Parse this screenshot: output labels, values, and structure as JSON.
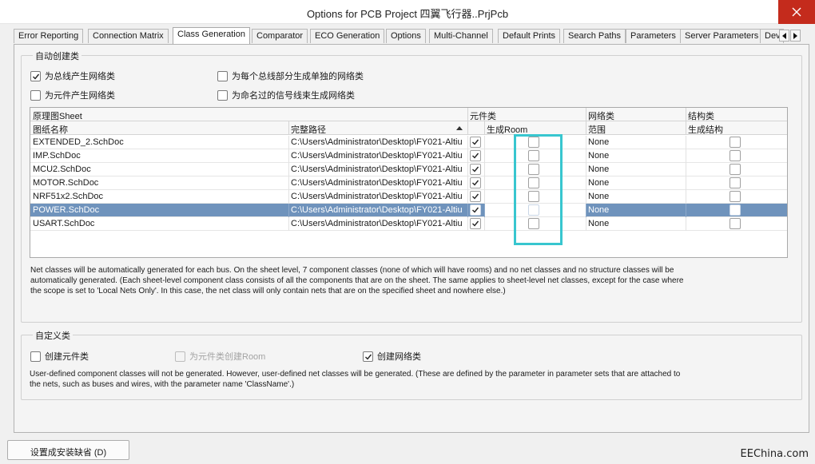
{
  "window": {
    "title": "Options for PCB Project 四翼飞行器..PrjPcb"
  },
  "tabs": [
    {
      "label": "Error Reporting",
      "active": false
    },
    {
      "label": "Connection Matrix",
      "active": false
    },
    {
      "label": "Class Generation",
      "active": true
    },
    {
      "label": "Comparator",
      "active": false
    },
    {
      "label": "ECO Generation",
      "active": false
    },
    {
      "label": "Options",
      "active": false
    },
    {
      "label": "Multi-Channel",
      "active": false
    },
    {
      "label": "Default Prints",
      "active": false
    },
    {
      "label": "Search Paths",
      "active": false
    },
    {
      "label": "Parameters",
      "active": false
    },
    {
      "label": "Server Parameters",
      "active": false
    },
    {
      "label": "Dev",
      "active": false
    }
  ],
  "auto_group": {
    "title": "自动创建类",
    "options": [
      {
        "label": "为总线产生网络类",
        "checked": true
      },
      {
        "label": "为元件产生网络类",
        "checked": false
      },
      {
        "label": "为每个总线部分生成单独的网络类",
        "checked": false
      },
      {
        "label": "为命名过的信号线束生成网络类",
        "checked": false
      }
    ],
    "grid": {
      "group_headers": [
        "原理图Sheet",
        "元件类",
        "网络类",
        "结构类"
      ],
      "columns": [
        "图纸名称",
        "完整路径",
        "生成Room",
        "范围",
        "生成结构"
      ],
      "rows": [
        {
          "sheet": "EXTENDED_2.SchDoc",
          "path": "C:\\Users\\Administrator\\Desktop\\FY021-Altiu",
          "component_class": true,
          "room": false,
          "scope": "None",
          "structure": false,
          "selected": false
        },
        {
          "sheet": "IMP.SchDoc",
          "path": "C:\\Users\\Administrator\\Desktop\\FY021-Altiu",
          "component_class": true,
          "room": false,
          "scope": "None",
          "structure": false,
          "selected": false
        },
        {
          "sheet": "MCU2.SchDoc",
          "path": "C:\\Users\\Administrator\\Desktop\\FY021-Altiu",
          "component_class": true,
          "room": false,
          "scope": "None",
          "structure": false,
          "selected": false
        },
        {
          "sheet": "MOTOR.SchDoc",
          "path": "C:\\Users\\Administrator\\Desktop\\FY021-Altiu",
          "component_class": true,
          "room": false,
          "scope": "None",
          "structure": false,
          "selected": false
        },
        {
          "sheet": "NRF51x2.SchDoc",
          "path": "C:\\Users\\Administrator\\Desktop\\FY021-Altiu",
          "component_class": true,
          "room": false,
          "scope": "None",
          "structure": false,
          "selected": false
        },
        {
          "sheet": "POWER.SchDoc",
          "path": "C:\\Users\\Administrator\\Desktop\\FY021-Altiu",
          "component_class": true,
          "room": false,
          "scope": "None",
          "structure": false,
          "selected": true
        },
        {
          "sheet": "USART.SchDoc",
          "path": "C:\\Users\\Administrator\\Desktop\\FY021-Altiu",
          "component_class": true,
          "room": false,
          "scope": "None",
          "structure": false,
          "selected": false
        }
      ]
    },
    "description_lines": [
      "Net classes will be automatically generated for each bus. On the sheet level, 7 component classes (none of which will have rooms) and no net classes and no structure classes will be",
      "automatically generated. (Each sheet-level component class consists of all the components that are on the sheet. The same applies to sheet-level net classes, except for the case where",
      "the scope is set to 'Local Nets Only'. In this case, the net class will only contain nets that are on the specified sheet and nowhere else.)"
    ]
  },
  "custom_group": {
    "title": "自定义类",
    "options": [
      {
        "label": "创建元件类",
        "checked": false,
        "disabled": false
      },
      {
        "label": "为元件类创建Room",
        "checked": false,
        "disabled": true
      },
      {
        "label": "创建网络类",
        "checked": true,
        "disabled": false
      }
    ],
    "description_lines": [
      "User-defined component classes will not be generated. However, user-defined net classes will be generated. (These are defined by the parameter in parameter sets that are attached to",
      "the nets, such as buses and wires, with the parameter name 'ClassName'.)"
    ]
  },
  "footer": {
    "defaults_button": "设置成安装缺省 (D)",
    "watermark": "EEChina.com"
  },
  "colors": {
    "selection_row": "#6f93bc",
    "annotation_highlight": "#38c6cf",
    "close_button": "#c42b1c"
  }
}
